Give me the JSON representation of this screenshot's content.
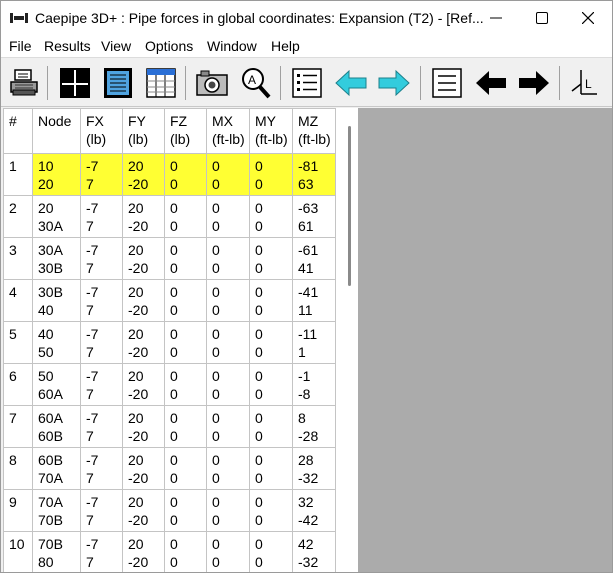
{
  "window": {
    "title": "Caepipe 3D+ : Pipe forces in global coordinates: Expansion (T2) -  [Ref..."
  },
  "menu": [
    "File",
    "Results",
    "View",
    "Options",
    "Window",
    "Help"
  ],
  "toolbar": {
    "icons": [
      "print-icon",
      "crosshair-icon",
      "document-view-icon",
      "table-view-icon",
      "camera-icon",
      "zoom-icon",
      "list-icon",
      "arrow-left-cyan-icon",
      "arrow-right-cyan-icon",
      "lines-icon",
      "arrow-left-black-icon",
      "arrow-right-black-icon",
      "axes-icon"
    ]
  },
  "table": {
    "headers": [
      {
        "line1": "#",
        "line2": ""
      },
      {
        "line1": "Node",
        "line2": ""
      },
      {
        "line1": "FX",
        "line2": "(lb)"
      },
      {
        "line1": "FY",
        "line2": "(lb)"
      },
      {
        "line1": "FZ",
        "line2": "(lb)"
      },
      {
        "line1": "MX",
        "line2": "(ft-lb)"
      },
      {
        "line1": "MY",
        "line2": "(ft-lb)"
      },
      {
        "line1": "MZ",
        "line2": "(ft-lb)"
      }
    ],
    "rows": [
      {
        "idx": "1",
        "node": [
          "10",
          "20"
        ],
        "fx": [
          "-7",
          "7"
        ],
        "fy": [
          "20",
          "-20"
        ],
        "fz": [
          "0",
          "0"
        ],
        "mx": [
          "0",
          "0"
        ],
        "my": [
          "0",
          "0"
        ],
        "mz": [
          "-81",
          "63"
        ]
      },
      {
        "idx": "2",
        "node": [
          "20",
          "30A"
        ],
        "fx": [
          "-7",
          "7"
        ],
        "fy": [
          "20",
          "-20"
        ],
        "fz": [
          "0",
          "0"
        ],
        "mx": [
          "0",
          "0"
        ],
        "my": [
          "0",
          "0"
        ],
        "mz": [
          "-63",
          "61"
        ]
      },
      {
        "idx": "3",
        "node": [
          "30A",
          "30B"
        ],
        "fx": [
          "-7",
          "7"
        ],
        "fy": [
          "20",
          "-20"
        ],
        "fz": [
          "0",
          "0"
        ],
        "mx": [
          "0",
          "0"
        ],
        "my": [
          "0",
          "0"
        ],
        "mz": [
          "-61",
          "41"
        ]
      },
      {
        "idx": "4",
        "node": [
          "30B",
          "40"
        ],
        "fx": [
          "-7",
          "7"
        ],
        "fy": [
          "20",
          "-20"
        ],
        "fz": [
          "0",
          "0"
        ],
        "mx": [
          "0",
          "0"
        ],
        "my": [
          "0",
          "0"
        ],
        "mz": [
          "-41",
          "11"
        ]
      },
      {
        "idx": "5",
        "node": [
          "40",
          "50"
        ],
        "fx": [
          "-7",
          "7"
        ],
        "fy": [
          "20",
          "-20"
        ],
        "fz": [
          "0",
          "0"
        ],
        "mx": [
          "0",
          "0"
        ],
        "my": [
          "0",
          "0"
        ],
        "mz": [
          "-11",
          "1"
        ]
      },
      {
        "idx": "6",
        "node": [
          "50",
          "60A"
        ],
        "fx": [
          "-7",
          "7"
        ],
        "fy": [
          "20",
          "-20"
        ],
        "fz": [
          "0",
          "0"
        ],
        "mx": [
          "0",
          "0"
        ],
        "my": [
          "0",
          "0"
        ],
        "mz": [
          "-1",
          "-8"
        ]
      },
      {
        "idx": "7",
        "node": [
          "60A",
          "60B"
        ],
        "fx": [
          "-7",
          "7"
        ],
        "fy": [
          "20",
          "-20"
        ],
        "fz": [
          "0",
          "0"
        ],
        "mx": [
          "0",
          "0"
        ],
        "my": [
          "0",
          "0"
        ],
        "mz": [
          "8",
          "-28"
        ]
      },
      {
        "idx": "8",
        "node": [
          "60B",
          "70A"
        ],
        "fx": [
          "-7",
          "7"
        ],
        "fy": [
          "20",
          "-20"
        ],
        "fz": [
          "0",
          "0"
        ],
        "mx": [
          "0",
          "0"
        ],
        "my": [
          "0",
          "0"
        ],
        "mz": [
          "28",
          "-32"
        ]
      },
      {
        "idx": "9",
        "node": [
          "70A",
          "70B"
        ],
        "fx": [
          "-7",
          "7"
        ],
        "fy": [
          "20",
          "-20"
        ],
        "fz": [
          "0",
          "0"
        ],
        "mx": [
          "0",
          "0"
        ],
        "my": [
          "0",
          "0"
        ],
        "mz": [
          "32",
          "-42"
        ]
      },
      {
        "idx": "10",
        "node": [
          "70B",
          "80"
        ],
        "fx": [
          "-7",
          "7"
        ],
        "fy": [
          "20",
          "-20"
        ],
        "fz": [
          "0",
          "0"
        ],
        "mx": [
          "0",
          "0"
        ],
        "my": [
          "0",
          "0"
        ],
        "mz": [
          "42",
          "-32"
        ]
      }
    ],
    "highlighted_row": 0,
    "highlight_color": "#ffff33"
  },
  "colors": {
    "accent_cyan": "#33ccdd",
    "empty_pane": "#ababab"
  }
}
